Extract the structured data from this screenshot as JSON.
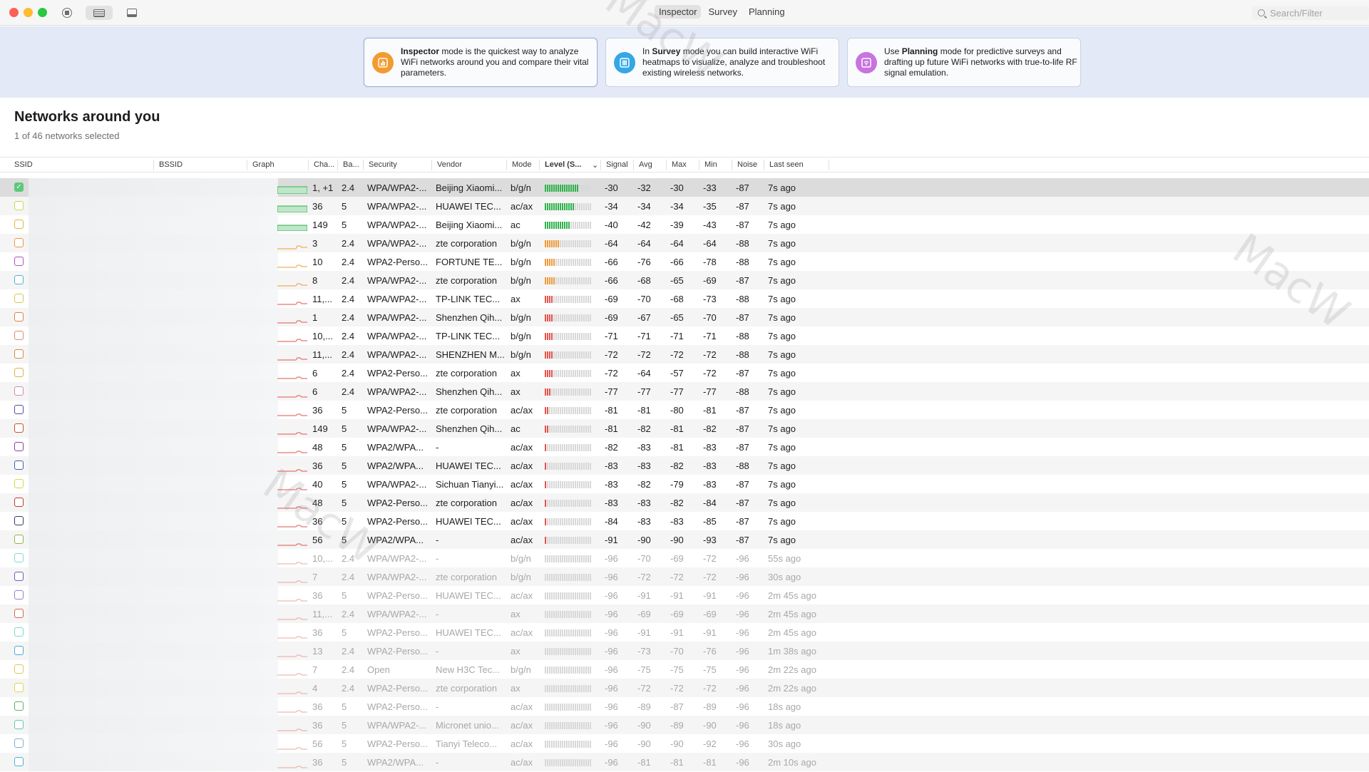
{
  "toolbar": {
    "modes": [
      "Inspector",
      "Survey",
      "Planning"
    ],
    "active_mode": "Inspector",
    "search_placeholder": "Search/Filter"
  },
  "colors": {
    "close": "#ff5f57",
    "minimize": "#febc2e",
    "maximize": "#28c840",
    "inspector": "#f39b2f",
    "survey": "#35a7e6",
    "planning": "#c773e0",
    "level_green": "#2fb24b",
    "level_orange": "#ef9a3c",
    "level_red": "#e4534a"
  },
  "cards": [
    {
      "bold": "Inspector",
      "pre": "",
      "post": " mode is the quickest way to analyze WiFi networks around you and compare their vital parameters.",
      "icon": "bar-chart-icon"
    },
    {
      "bold": "Survey",
      "pre": "In ",
      "post": " mode you can build interactive WiFi heatmaps to visualize, analyze and troubleshoot existing wireless networks.",
      "icon": "columns-icon"
    },
    {
      "bold": "Planning",
      "pre": "Use ",
      "post": " mode for predictive surveys and drafting up future WiFi networks with true-to-life RF signal emulation.",
      "icon": "wifi-icon"
    }
  ],
  "page": {
    "title": "Networks around you",
    "subtitle": "1 of 46 networks selected"
  },
  "columns": [
    "SSID",
    "BSSID",
    "Graph",
    "Cha...",
    "Ba...",
    "Security",
    "Vendor",
    "Mode",
    "Level (S...",
    "Signal",
    "Avg",
    "Max",
    "Min",
    "Noise",
    "Last seen"
  ],
  "rows": [
    {
      "ch": "1, +1",
      "band": "2.4",
      "sec": "WPA/WPA2-...",
      "vendor": "Beijing Xiaomi...",
      "mode": "b/g/n",
      "level": 0.72,
      "lc": "green",
      "signal": "-30",
      "avg": "-32",
      "max": "-30",
      "min": "-33",
      "noise": "-87",
      "seen": "7s ago",
      "cb": "#5cc97a",
      "checked": true,
      "stale": false
    },
    {
      "ch": "36",
      "band": "5",
      "sec": "WPA/WPA2-...",
      "vendor": "HUAWEI TEC...",
      "mode": "ac/ax",
      "level": 0.62,
      "lc": "green",
      "signal": "-34",
      "avg": "-34",
      "max": "-34",
      "min": "-35",
      "noise": "-87",
      "seen": "7s ago",
      "cb": "#c7d94a",
      "checked": false,
      "stale": false
    },
    {
      "ch": "149",
      "band": "5",
      "sec": "WPA/WPA2-...",
      "vendor": "Beijing Xiaomi...",
      "mode": "ac",
      "level": 0.55,
      "lc": "green",
      "signal": "-40",
      "avg": "-42",
      "max": "-39",
      "min": "-43",
      "noise": "-87",
      "seen": "7s ago",
      "cb": "#e0b341",
      "checked": false,
      "stale": false
    },
    {
      "ch": "3",
      "band": "2.4",
      "sec": "WPA/WPA2-...",
      "vendor": "zte corporation",
      "mode": "b/g/n",
      "level": 0.3,
      "lc": "orange",
      "signal": "-64",
      "avg": "-64",
      "max": "-64",
      "min": "-64",
      "noise": "-88",
      "seen": "7s ago",
      "cb": "#e89a3c",
      "checked": false,
      "stale": false
    },
    {
      "ch": "10",
      "band": "2.4",
      "sec": "WPA2-Perso...",
      "vendor": "FORTUNE TE...",
      "mode": "b/g/n",
      "level": 0.24,
      "lc": "orange",
      "signal": "-66",
      "avg": "-76",
      "max": "-66",
      "min": "-78",
      "noise": "-88",
      "seen": "7s ago",
      "cb": "#b24fc0",
      "checked": false,
      "stale": false
    },
    {
      "ch": "8",
      "band": "2.4",
      "sec": "WPA/WPA2-...",
      "vendor": "zte corporation",
      "mode": "b/g/n",
      "level": 0.24,
      "lc": "orange",
      "signal": "-66",
      "avg": "-68",
      "max": "-65",
      "min": "-69",
      "noise": "-87",
      "seen": "7s ago",
      "cb": "#4fb3d9",
      "checked": false,
      "stale": false
    },
    {
      "ch": "11,...",
      "band": "2.4",
      "sec": "WPA/WPA2-...",
      "vendor": "TP-LINK TEC...",
      "mode": "ax",
      "level": 0.2,
      "lc": "red",
      "signal": "-69",
      "avg": "-70",
      "max": "-68",
      "min": "-73",
      "noise": "-88",
      "seen": "7s ago",
      "cb": "#d9c84a",
      "checked": false,
      "stale": false
    },
    {
      "ch": "1",
      "band": "2.4",
      "sec": "WPA/WPA2-...",
      "vendor": "Shenzhen Qih...",
      "mode": "b/g/n",
      "level": 0.2,
      "lc": "red",
      "signal": "-69",
      "avg": "-67",
      "max": "-65",
      "min": "-70",
      "noise": "-87",
      "seen": "7s ago",
      "cb": "#e0804a",
      "checked": false,
      "stale": false
    },
    {
      "ch": "10,...",
      "band": "2.4",
      "sec": "WPA/WPA2-...",
      "vendor": "TP-LINK TEC...",
      "mode": "b/g/n",
      "level": 0.18,
      "lc": "red",
      "signal": "-71",
      "avg": "-71",
      "max": "-71",
      "min": "-71",
      "noise": "-88",
      "seen": "7s ago",
      "cb": "#e08a6a",
      "checked": false,
      "stale": false
    },
    {
      "ch": "11,...",
      "band": "2.4",
      "sec": "WPA/WPA2-...",
      "vendor": "SHENZHEN M...",
      "mode": "b/g/n",
      "level": 0.18,
      "lc": "red",
      "signal": "-72",
      "avg": "-72",
      "max": "-72",
      "min": "-72",
      "noise": "-88",
      "seen": "7s ago",
      "cb": "#d98a3c",
      "checked": false,
      "stale": false
    },
    {
      "ch": "6",
      "band": "2.4",
      "sec": "WPA2-Perso...",
      "vendor": "zte corporation",
      "mode": "ax",
      "level": 0.16,
      "lc": "red",
      "signal": "-72",
      "avg": "-64",
      "max": "-57",
      "min": "-72",
      "noise": "-87",
      "seen": "7s ago",
      "cb": "#d9b24a",
      "checked": false,
      "stale": false
    },
    {
      "ch": "6",
      "band": "2.4",
      "sec": "WPA/WPA2-...",
      "vendor": "Shenzhen Qih...",
      "mode": "ax",
      "level": 0.12,
      "lc": "red",
      "signal": "-77",
      "avg": "-77",
      "max": "-77",
      "min": "-77",
      "noise": "-88",
      "seen": "7s ago",
      "cb": "#d08ab0",
      "checked": false,
      "stale": false
    },
    {
      "ch": "36",
      "band": "5",
      "sec": "WPA2-Perso...",
      "vendor": "zte corporation",
      "mode": "ac/ax",
      "level": 0.08,
      "lc": "red",
      "signal": "-81",
      "avg": "-81",
      "max": "-80",
      "min": "-81",
      "noise": "-87",
      "seen": "7s ago",
      "cb": "#4a4fa8",
      "checked": false,
      "stale": false
    },
    {
      "ch": "149",
      "band": "5",
      "sec": "WPA/WPA2-...",
      "vendor": "Shenzhen Qih...",
      "mode": "ac",
      "level": 0.08,
      "lc": "red",
      "signal": "-81",
      "avg": "-82",
      "max": "-81",
      "min": "-82",
      "noise": "-87",
      "seen": "7s ago",
      "cb": "#c8502f",
      "checked": false,
      "stale": false
    },
    {
      "ch": "48",
      "band": "5",
      "sec": "WPA2/WPA...",
      "vendor": "-",
      "mode": "ac/ax",
      "level": 0.05,
      "lc": "red",
      "signal": "-82",
      "avg": "-83",
      "max": "-81",
      "min": "-83",
      "noise": "-87",
      "seen": "7s ago",
      "cb": "#8a3fa8",
      "checked": false,
      "stale": false
    },
    {
      "ch": "36",
      "band": "5",
      "sec": "WPA2/WPA...",
      "vendor": "HUAWEI TEC...",
      "mode": "ac/ax",
      "level": 0.05,
      "lc": "red",
      "signal": "-83",
      "avg": "-83",
      "max": "-82",
      "min": "-83",
      "noise": "-88",
      "seen": "7s ago",
      "cb": "#3f5fb0",
      "checked": false,
      "stale": false
    },
    {
      "ch": "40",
      "band": "5",
      "sec": "WPA/WPA2-...",
      "vendor": "Sichuan Tianyi...",
      "mode": "ac/ax",
      "level": 0.05,
      "lc": "red",
      "signal": "-83",
      "avg": "-82",
      "max": "-79",
      "min": "-83",
      "noise": "-87",
      "seen": "7s ago",
      "cb": "#cfd94a",
      "checked": false,
      "stale": false
    },
    {
      "ch": "48",
      "band": "5",
      "sec": "WPA2-Perso...",
      "vendor": "zte corporation",
      "mode": "ac/ax",
      "level": 0.05,
      "lc": "red",
      "signal": "-83",
      "avg": "-83",
      "max": "-82",
      "min": "-84",
      "noise": "-87",
      "seen": "7s ago",
      "cb": "#c0392b",
      "checked": false,
      "stale": false
    },
    {
      "ch": "36",
      "band": "5",
      "sec": "WPA2-Perso...",
      "vendor": "HUAWEI TEC...",
      "mode": "ac/ax",
      "level": 0.05,
      "lc": "red",
      "signal": "-84",
      "avg": "-83",
      "max": "-83",
      "min": "-85",
      "noise": "-87",
      "seen": "7s ago",
      "cb": "#3a3a6a",
      "checked": false,
      "stale": false
    },
    {
      "ch": "56",
      "band": "5",
      "sec": "WPA2/WPA...",
      "vendor": "-",
      "mode": "ac/ax",
      "level": 0.02,
      "lc": "red",
      "signal": "-91",
      "avg": "-90",
      "max": "-90",
      "min": "-93",
      "noise": "-87",
      "seen": "7s ago",
      "cb": "#8ab83c",
      "checked": false,
      "stale": false
    },
    {
      "ch": "10,...",
      "band": "2.4",
      "sec": "WPA/WPA2-...",
      "vendor": "-",
      "mode": "b/g/n",
      "level": 0,
      "lc": "red",
      "signal": "-96",
      "avg": "-70",
      "max": "-69",
      "min": "-72",
      "noise": "-96",
      "seen": "55s ago",
      "cb": "#7fd9d9",
      "checked": false,
      "stale": true
    },
    {
      "ch": "7",
      "band": "2.4",
      "sec": "WPA/WPA2-...",
      "vendor": "zte corporation",
      "mode": "b/g/n",
      "level": 0,
      "lc": "red",
      "signal": "-96",
      "avg": "-72",
      "max": "-72",
      "min": "-72",
      "noise": "-96",
      "seen": "30s ago",
      "cb": "#6a5fb0",
      "checked": false,
      "stale": true
    },
    {
      "ch": "36",
      "band": "5",
      "sec": "WPA2-Perso...",
      "vendor": "HUAWEI TEC...",
      "mode": "ac/ax",
      "level": 0,
      "lc": "red",
      "signal": "-96",
      "avg": "-91",
      "max": "-91",
      "min": "-91",
      "noise": "-96",
      "seen": "2m 45s ago",
      "cb": "#9a7fd0",
      "checked": false,
      "stale": true
    },
    {
      "ch": "11,...",
      "band": "2.4",
      "sec": "WPA/WPA2-...",
      "vendor": "-",
      "mode": "ax",
      "level": 0,
      "lc": "red",
      "signal": "-96",
      "avg": "-69",
      "max": "-69",
      "min": "-69",
      "noise": "-96",
      "seen": "2m 45s ago",
      "cb": "#d06a4a",
      "checked": false,
      "stale": true
    },
    {
      "ch": "36",
      "band": "5",
      "sec": "WPA2-Perso...",
      "vendor": "HUAWEI TEC...",
      "mode": "ac/ax",
      "level": 0,
      "lc": "red",
      "signal": "-96",
      "avg": "-91",
      "max": "-91",
      "min": "-91",
      "noise": "-96",
      "seen": "2m 45s ago",
      "cb": "#7ad9c0",
      "checked": false,
      "stale": true
    },
    {
      "ch": "13",
      "band": "2.4",
      "sec": "WPA2-Perso...",
      "vendor": "-",
      "mode": "ax",
      "level": 0,
      "lc": "red",
      "signal": "-96",
      "avg": "-73",
      "max": "-70",
      "min": "-76",
      "noise": "-96",
      "seen": "1m 38s ago",
      "cb": "#4aa8d9",
      "checked": false,
      "stale": true
    },
    {
      "ch": "7",
      "band": "2.4",
      "sec": "Open",
      "vendor": "New H3C Tec...",
      "mode": "b/g/n",
      "level": 0,
      "lc": "red",
      "signal": "-96",
      "avg": "-75",
      "max": "-75",
      "min": "-75",
      "noise": "-96",
      "seen": "2m 22s ago",
      "cb": "#e0c85a",
      "checked": false,
      "stale": true
    },
    {
      "ch": "4",
      "band": "2.4",
      "sec": "WPA2-Perso...",
      "vendor": "zte corporation",
      "mode": "ax",
      "level": 0,
      "lc": "red",
      "signal": "-96",
      "avg": "-72",
      "max": "-72",
      "min": "-72",
      "noise": "-96",
      "seen": "2m 22s ago",
      "cb": "#d9d94a",
      "checked": false,
      "stale": true
    },
    {
      "ch": "36",
      "band": "5",
      "sec": "WPA2-Perso...",
      "vendor": "-",
      "mode": "ac/ax",
      "level": 0,
      "lc": "red",
      "signal": "-96",
      "avg": "-89",
      "max": "-87",
      "min": "-89",
      "noise": "-96",
      "seen": "18s ago",
      "cb": "#5fb06a",
      "checked": false,
      "stale": true
    },
    {
      "ch": "36",
      "band": "5",
      "sec": "WPA/WPA2-...",
      "vendor": "Micronet unio...",
      "mode": "ac/ax",
      "level": 0,
      "lc": "red",
      "signal": "-96",
      "avg": "-90",
      "max": "-89",
      "min": "-90",
      "noise": "-96",
      "seen": "18s ago",
      "cb": "#5fc8b0",
      "checked": false,
      "stale": true
    },
    {
      "ch": "56",
      "band": "5",
      "sec": "WPA2-Perso...",
      "vendor": "Tianyi Teleco...",
      "mode": "ac/ax",
      "level": 0,
      "lc": "red",
      "signal": "-96",
      "avg": "-90",
      "max": "-90",
      "min": "-92",
      "noise": "-96",
      "seen": "30s ago",
      "cb": "#7ab0d9",
      "checked": false,
      "stale": true
    },
    {
      "ch": "36",
      "band": "5",
      "sec": "WPA2/WPA...",
      "vendor": "-",
      "mode": "ac/ax",
      "level": 0,
      "lc": "red",
      "signal": "-96",
      "avg": "-81",
      "max": "-81",
      "min": "-81",
      "noise": "-96",
      "seen": "2m 10s ago",
      "cb": "#4ab0d9",
      "checked": false,
      "stale": true
    }
  ]
}
